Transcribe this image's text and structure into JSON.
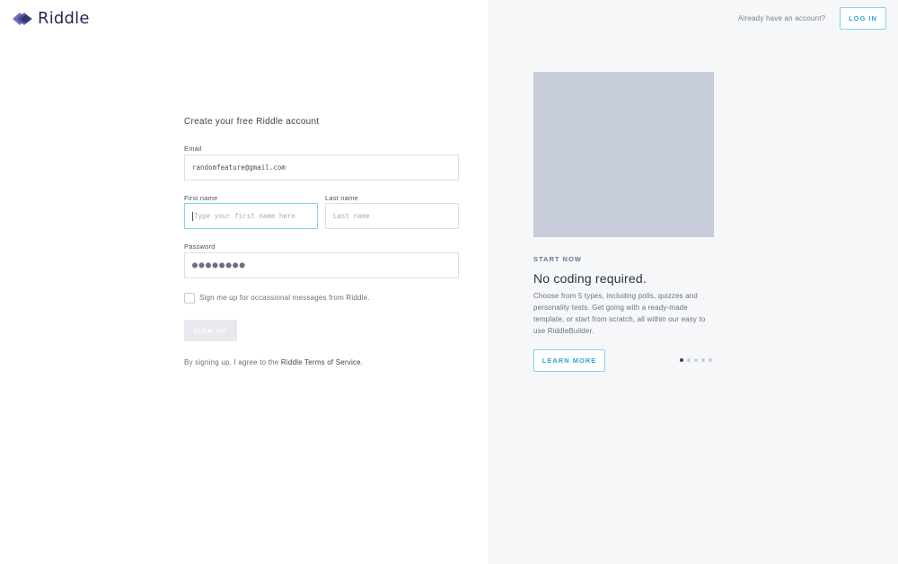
{
  "brand": {
    "name": "Riddle",
    "color": "#232a52"
  },
  "header": {
    "already_text": "Already have an account?",
    "login_label": "LOG IN"
  },
  "form": {
    "title": "Create your free Riddle account",
    "email": {
      "label": "Email",
      "value": "randomfeature@gmail.com"
    },
    "first_name": {
      "label": "First name",
      "placeholder": "Type your first name here"
    },
    "last_name": {
      "label": "Last name",
      "placeholder": "Last name"
    },
    "password": {
      "label": "Password",
      "value_masked": "●●●●●●●●"
    },
    "newsletter_label": "Sign me up for occassional messages from Riddle.",
    "signup_label": "SIGN UP",
    "terms_prefix": "By signing up, I agree to the ",
    "terms_link": "Riddle Terms of Service."
  },
  "promo": {
    "eyebrow": "START NOW",
    "headline": "No coding required.",
    "description": "Choose from 5 types, including polls, quizzes and personality tests. Get going with a ready-made template, or start from scratch, all within our easy to use RiddleBuilder.",
    "learn_more_label": "LEARN MORE",
    "carousel": {
      "total": 5,
      "active": 1
    }
  },
  "colors": {
    "accent": "#2aa9d2",
    "accent_border": "#7fd4ea",
    "panel_bg": "#f6f7f9",
    "image_placeholder": "#c6ccd9"
  }
}
